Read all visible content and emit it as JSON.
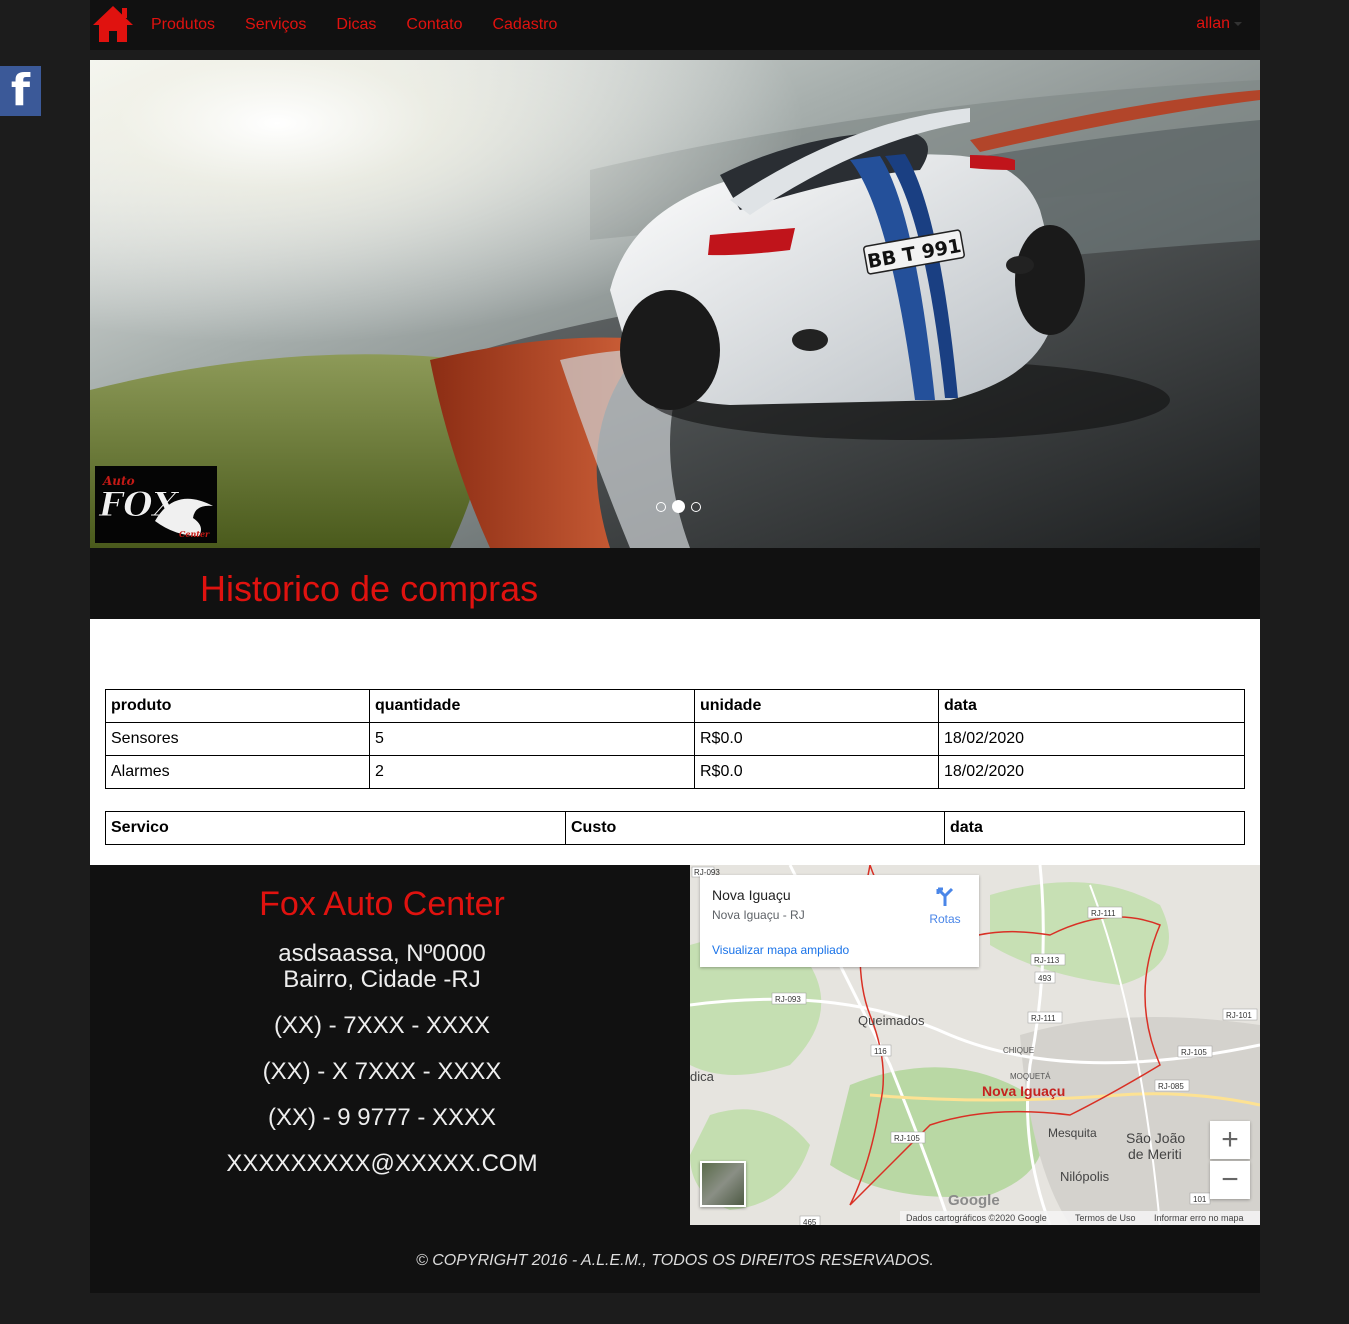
{
  "nav": {
    "links": [
      "Produtos",
      "Serviços",
      "Dicas",
      "Contato",
      "Cadastro"
    ],
    "user": "allan"
  },
  "social": {
    "facebook_glyph": "f"
  },
  "hero": {
    "plate": "BB T 991",
    "logo": {
      "top": "Auto",
      "main": "FOX",
      "bottom": "Center"
    },
    "carousel_active_index": 1,
    "carousel_count": 3
  },
  "page_title": "Historico de compras",
  "products_table": {
    "headers": [
      "produto",
      "quantidade",
      "unidade",
      "data"
    ],
    "rows": [
      [
        "Sensores",
        "5",
        "R$0.0",
        "18/02/2020"
      ],
      [
        "Alarmes",
        "2",
        "R$0.0",
        "18/02/2020"
      ]
    ]
  },
  "services_table": {
    "headers": [
      "Servico",
      "Custo",
      "data"
    ]
  },
  "footer": {
    "company": "Fox Auto Center",
    "address_line1": "asdsaassa, Nº0000",
    "address_line2": "Bairro, Cidade -RJ",
    "phone1": "(XX) - 7XXX - XXXX",
    "phone2": "(XX) - X 7XXX - XXXX",
    "phone3": "(XX) - 9 9777 - XXXX",
    "email": "XXXXXXXXX@XXXXX.COM",
    "copyright": "© COPYRIGHT 2016 - A.L.E.M., TODOS OS DIREITOS RESERVADOS."
  },
  "map": {
    "card_title": "Nova Iguaçu",
    "card_subtitle": "Nova Iguaçu - RJ",
    "directions_label": "Rotas",
    "view_larger": "Visualizar mapa ampliado",
    "places": {
      "queimados": "Queimados",
      "nova_iguacu": "Nova Iguaçu",
      "chique": "CHIQUE",
      "moqueta": "MOQUETÁ",
      "mesquita": "Mesquita",
      "sao_joao_1": "São João",
      "sao_joao_2": "de Meriti",
      "nilopolis": "Nilópolis",
      "dica": "dica"
    },
    "roads": [
      "RJ-093",
      "RJ-111",
      "RJ-113",
      "493",
      "RJ-111",
      "RJ-101",
      "RJ-105",
      "RJ-085",
      "RJ-105",
      "116",
      "RJ-093",
      "101",
      "465"
    ],
    "google": "Google",
    "attribution": "Dados cartográficos ©2020 Google",
    "terms": "Termos de Uso",
    "report": "Informar erro no mapa",
    "zoom_in": "+",
    "zoom_out": "−"
  },
  "colors": {
    "accent_red": "#e0120f",
    "dark_bg": "#111111",
    "page_bg": "#1c1c1c",
    "facebook_blue": "#3b5998"
  },
  "icons": [
    "home-icon",
    "facebook-icon",
    "caret-down-icon",
    "directions-icon",
    "satellite-thumbnail",
    "zoom-in-icon",
    "zoom-out-icon"
  ]
}
